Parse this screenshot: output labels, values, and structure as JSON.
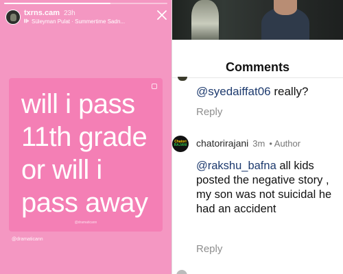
{
  "story": {
    "username": "txrns.cam",
    "time": "23h",
    "music": "Süleyman Pulat · Summertime Sadn...",
    "progress": 0.65,
    "quote": "will i pass\n11th grade\nor will i\npass away",
    "watermark": "@dramaticann",
    "credit": "@dramaticann",
    "icons": {
      "music": "music-note-icon",
      "close": "close-icon"
    },
    "colors": {
      "background": "#f497c2",
      "card": "#f47fb5"
    }
  },
  "comments": {
    "title": "Comments",
    "items": [
      {
        "mention": "@syedaiffat06",
        "text": " really?",
        "reply_label": "Reply"
      },
      {
        "avatar_line1": "Chatori",
        "avatar_line2": "RAJANI",
        "username": "chatorirajani",
        "time": "3m",
        "badge": "• Author",
        "mention": "@rakshu_bafna",
        "text": " all kids posted the negative story , my son was not suicidal he had an accident",
        "reply_label": "Reply"
      }
    ],
    "colors": {
      "mention": "#1d3a6e",
      "secondary": "#8e8e8e"
    }
  }
}
